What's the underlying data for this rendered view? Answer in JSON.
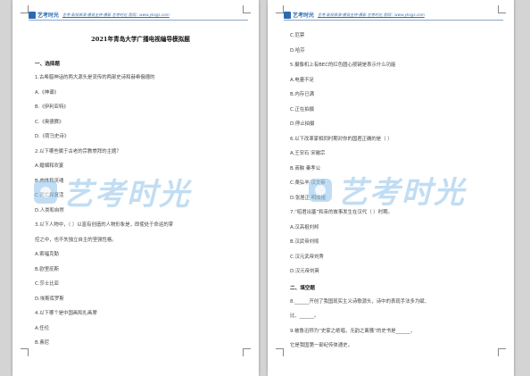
{
  "header": {
    "logo_text": "艺考时光",
    "info": "艺考·影视表演·播音主持·摄影 艺考时光 官网：www.yksgs.com"
  },
  "watermark": {
    "text": "艺考时光",
    "color": "#8fc3ea"
  },
  "left_page": {
    "title": "2021年青岛大学广播电视编导模拟题",
    "section1": "一、选择题",
    "lines": [
      "1.古希腊神话的两大源头是流传的两部史诗和赫希俄德的",
      "A.《神谱》",
      "B.《伊利亚特》",
      "C.《奥德赛》",
      "D.《荷马史诗》",
      "2.以下哪些属于古老的宗教崇拜的主题？",
      "A.婚姻和欢宴",
      "B.肉体和灵魂",
      "C.死亡和复活",
      "D.人类和自然",
      "3.以下人物中，（ ）以富有创造的人物形象是，即使处于命运的掌",
      "控之中，也不失独立自主的坚强性格。",
      "A.索福克勒",
      "B.欧里庇斯",
      "C.莎士比亚",
      "D.埃斯库罗斯",
      "4.以下哪个是中国画和扎画摩",
      "A.任伦",
      "B.素尼"
    ]
  },
  "right_page": {
    "lines": [
      "C.厄禁",
      "D.哈芬",
      "5.摄像机上有BEC的红色圆心按键是表示什么功能",
      "A.电量不足",
      "B.内存已满",
      "C.正在拍摄",
      "D.停止拍摄",
      "6.以下改革家相同时期对你的国君正确的是（ ）",
      "A.王安石 宋徽宗",
      "B.商鞅 秦孝公",
      "C.桑弘羊 汉文帝",
      "D.张居正 明成祖",
      "7.“昭君出塞”和亲的故事发生在汉代（ ）时期。",
      "A.汉高祖刘邦",
      "B.汉武帝刘彻",
      "C.汉元武帝刘秀",
      "D.汉元帝刘奭"
    ],
    "section2": "二、填空题",
    "fill": [
      "8.______开创了我国现实主义诗歌源头，诗中的表现手法多为赋、",
      "比、______。",
      "9.被鲁迅称为“史家之绝唱，无韵之离骚”的史书是______，",
      "它是我国第一部纪传体通史。"
    ]
  }
}
